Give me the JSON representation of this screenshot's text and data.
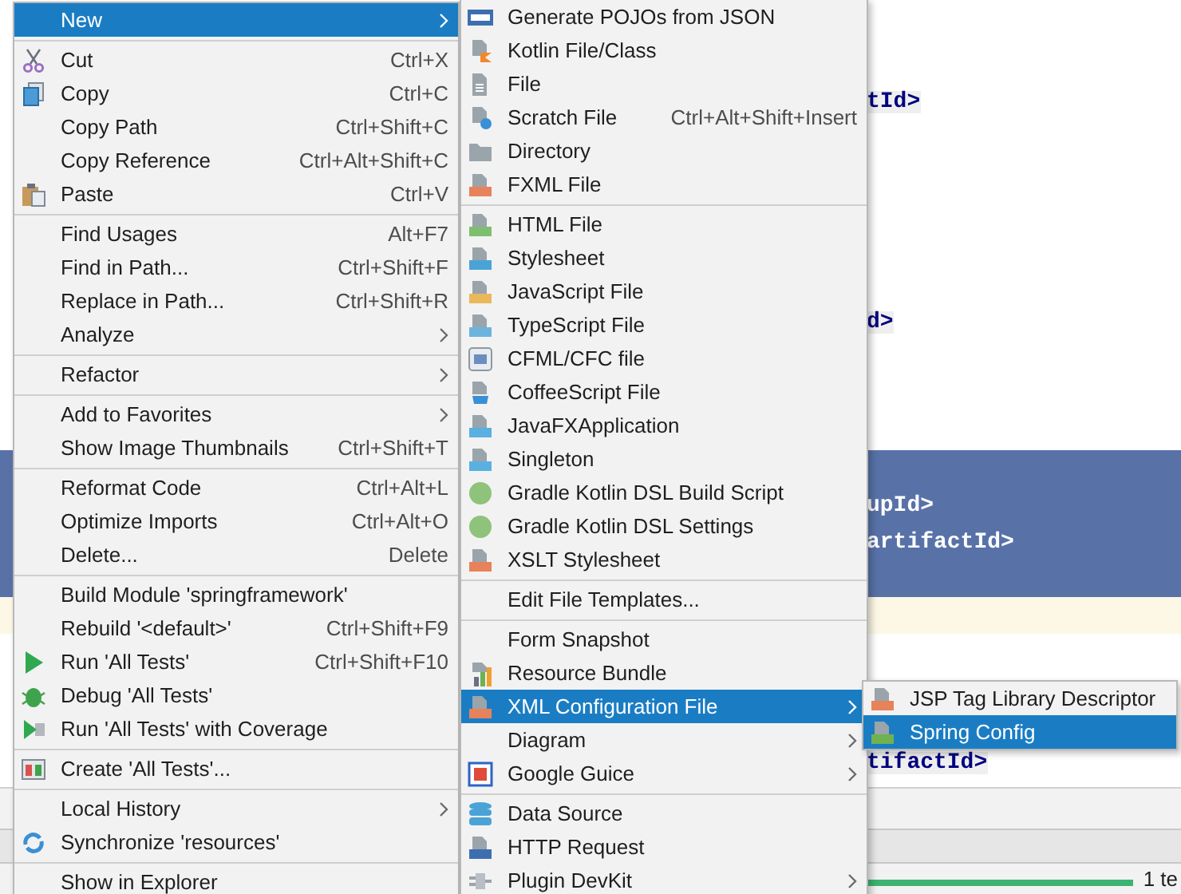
{
  "editor": {
    "lines": [
      {
        "selected": false
      },
      {
        "selected": false
      },
      {
        "text": "tId>",
        "selected": false,
        "matched": true
      },
      {
        "selected": false
      },
      {
        "selected": false
      },
      {
        "selected": false
      },
      {
        "selected": false
      },
      {
        "selected": false
      },
      {
        "text": "d>",
        "selected": false,
        "matched": true
      },
      {
        "selected": false
      },
      {
        "selected": false
      },
      {
        "selected": false
      },
      {
        "selected": true
      },
      {
        "text": "upId>",
        "selected": true,
        "matched": false
      },
      {
        "text": "artifactId>",
        "selected": true,
        "matched": false
      },
      {
        "selected": true
      },
      {
        "selected": false,
        "current": true
      },
      {
        "selected": false
      },
      {
        "selected": false
      },
      {
        "selected": false
      },
      {
        "text": "tifactId>",
        "selected": false,
        "matched": true
      }
    ]
  },
  "status_bar": {
    "progress": {
      "level": 1
    },
    "text": "1 te"
  },
  "menus": [
    {
      "items": [
        {
          "kind": "item",
          "label": "New",
          "selected": true,
          "submenu": true
        },
        {
          "kind": "separator"
        },
        {
          "kind": "item",
          "label": "Cut",
          "shortcut": "Ctrl+X",
          "selected": false
        },
        {
          "kind": "item",
          "label": "Copy",
          "shortcut": "Ctrl+C",
          "selected": false
        },
        {
          "kind": "item",
          "label": "Copy Path",
          "shortcut": "Ctrl+Shift+C",
          "selected": false
        },
        {
          "kind": "item",
          "label": "Copy Reference",
          "shortcut": "Ctrl+Alt+Shift+C",
          "selected": false
        },
        {
          "kind": "item",
          "label": "Paste",
          "shortcut": "Ctrl+V",
          "selected": false
        },
        {
          "kind": "separator"
        },
        {
          "kind": "item",
          "label": "Find Usages",
          "shortcut": "Alt+F7",
          "selected": false
        },
        {
          "kind": "item",
          "label": "Find in Path...",
          "shortcut": "Ctrl+Shift+F",
          "selected": false
        },
        {
          "kind": "item",
          "label": "Replace in Path...",
          "shortcut": "Ctrl+Shift+R",
          "selected": false
        },
        {
          "kind": "item",
          "label": "Analyze",
          "selected": false,
          "submenu": true
        },
        {
          "kind": "separator"
        },
        {
          "kind": "item",
          "label": "Refactor",
          "selected": false,
          "submenu": true
        },
        {
          "kind": "separator"
        },
        {
          "kind": "item",
          "label": "Add to Favorites",
          "selected": false,
          "submenu": true
        },
        {
          "kind": "item",
          "label": "Show Image Thumbnails",
          "shortcut": "Ctrl+Shift+T",
          "selected": false
        },
        {
          "kind": "separator"
        },
        {
          "kind": "item",
          "label": "Reformat Code",
          "shortcut": "Ctrl+Alt+L",
          "selected": false
        },
        {
          "kind": "item",
          "label": "Optimize Imports",
          "shortcut": "Ctrl+Alt+O",
          "selected": false
        },
        {
          "kind": "item",
          "label": "Delete...",
          "shortcut": "Delete",
          "selected": false
        },
        {
          "kind": "separator"
        },
        {
          "kind": "item",
          "label": "Build Module 'springframework'",
          "selected": false
        },
        {
          "kind": "item",
          "label": "Rebuild '<default>'",
          "shortcut": "Ctrl+Shift+F9",
          "selected": false
        },
        {
          "kind": "item",
          "label": "Run 'All Tests'",
          "shortcut": "Ctrl+Shift+F10",
          "selected": false
        },
        {
          "kind": "item",
          "label": "Debug 'All Tests'",
          "selected": false
        },
        {
          "kind": "item",
          "label": "Run 'All Tests' with Coverage",
          "selected": false
        },
        {
          "kind": "separator"
        },
        {
          "kind": "item",
          "label": "Create 'All Tests'...",
          "selected": false
        },
        {
          "kind": "separator"
        },
        {
          "kind": "item",
          "label": "Local History",
          "selected": false,
          "submenu": true
        },
        {
          "kind": "item",
          "label": "Synchronize 'resources'",
          "selected": false
        },
        {
          "kind": "separator"
        },
        {
          "kind": "item",
          "label": "Show in Explorer",
          "selected": false
        }
      ]
    },
    {
      "items": [
        {
          "kind": "item",
          "label": "Generate POJOs from JSON",
          "selected": false
        },
        {
          "kind": "item",
          "label": "Kotlin File/Class",
          "selected": false
        },
        {
          "kind": "item",
          "label": "File",
          "selected": false
        },
        {
          "kind": "item",
          "label": "Scratch File",
          "shortcut": "Ctrl+Alt+Shift+Insert",
          "selected": false
        },
        {
          "kind": "item",
          "label": "Directory",
          "selected": false
        },
        {
          "kind": "item",
          "label": "FXML File",
          "selected": false
        },
        {
          "kind": "separator"
        },
        {
          "kind": "item",
          "label": "HTML File",
          "selected": false
        },
        {
          "kind": "item",
          "label": "Stylesheet",
          "selected": false
        },
        {
          "kind": "item",
          "label": "JavaScript File",
          "selected": false
        },
        {
          "kind": "item",
          "label": "TypeScript File",
          "selected": false
        },
        {
          "kind": "item",
          "label": "CFML/CFC file",
          "selected": false
        },
        {
          "kind": "item",
          "label": "CoffeeScript File",
          "selected": false
        },
        {
          "kind": "item",
          "label": "JavaFXApplication",
          "selected": false
        },
        {
          "kind": "item",
          "label": "Singleton",
          "selected": false
        },
        {
          "kind": "item",
          "label": "Gradle Kotlin DSL Build Script",
          "selected": false
        },
        {
          "kind": "item",
          "label": "Gradle Kotlin DSL Settings",
          "selected": false
        },
        {
          "kind": "item",
          "label": "XSLT Stylesheet",
          "selected": false
        },
        {
          "kind": "separator"
        },
        {
          "kind": "item",
          "label": "Edit File Templates...",
          "selected": false
        },
        {
          "kind": "separator"
        },
        {
          "kind": "item",
          "label": "Form Snapshot",
          "selected": false
        },
        {
          "kind": "item",
          "label": "Resource Bundle",
          "selected": false
        },
        {
          "kind": "item",
          "label": "XML Configuration File",
          "selected": true,
          "submenu": true
        },
        {
          "kind": "item",
          "label": "Diagram",
          "selected": false,
          "submenu": true
        },
        {
          "kind": "item",
          "label": "Google Guice",
          "selected": false,
          "submenu": true
        },
        {
          "kind": "separator"
        },
        {
          "kind": "item",
          "label": "Data Source",
          "selected": false
        },
        {
          "kind": "item",
          "label": "HTTP Request",
          "selected": false
        },
        {
          "kind": "item",
          "label": "Plugin DevKit",
          "selected": false,
          "submenu": true
        }
      ]
    },
    {
      "items": [
        {
          "kind": "item",
          "label": "JSP Tag Library Descriptor",
          "selected": false
        },
        {
          "kind": "item",
          "label": "Spring Config",
          "selected": true
        }
      ]
    }
  ]
}
